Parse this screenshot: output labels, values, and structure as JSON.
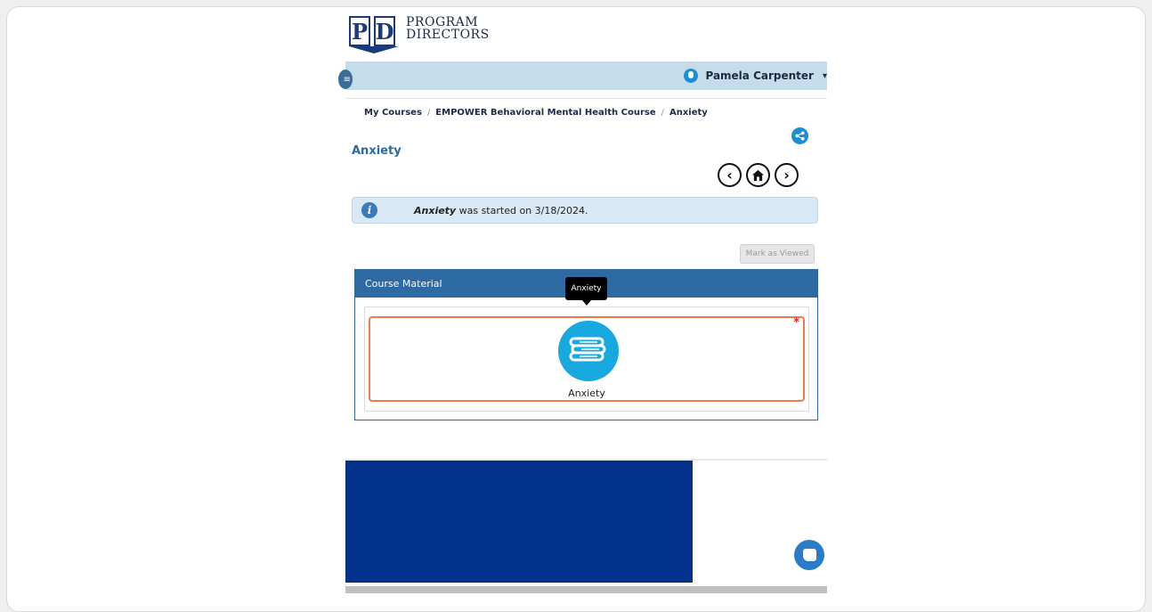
{
  "brand": {
    "logo_letters": "PD",
    "name_line1": "PROGRAM",
    "name_line2": "DIRECTORS"
  },
  "header": {
    "user_name": "Pamela Carpenter"
  },
  "breadcrumb": [
    {
      "label": "My Courses"
    },
    {
      "label": "EMPOWER Behavioral Mental Health Course"
    },
    {
      "label": "Anxiety"
    }
  ],
  "page_title": "Anxiety",
  "info": {
    "emphasis": "Anxiety",
    "text": "was started on 3/18/2024."
  },
  "mark_as_viewed_label": "Mark as Viewed",
  "course_material": {
    "heading": "Course Material",
    "tooltip": "Anxiety",
    "item_label": "Anxiety",
    "required_marker": "*"
  },
  "colors": {
    "accent": "#2e6aa2",
    "footer_blue": "#01318b",
    "highlight": "#f07b4f",
    "icon_blue": "#18a8e0"
  }
}
